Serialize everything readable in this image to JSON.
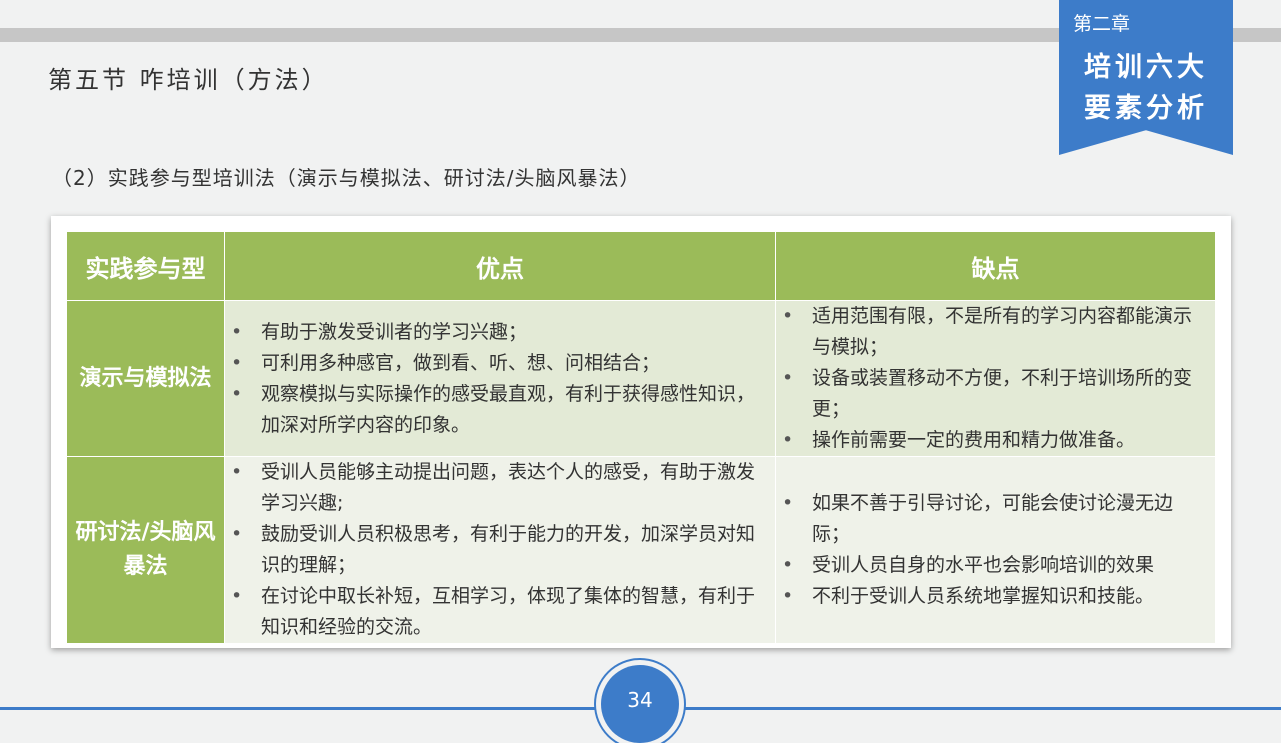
{
  "ribbon": {
    "chapter": "第二章",
    "line1": "培训六大",
    "line2": "要素分析"
  },
  "section_title": "第五节  咋培训（方法）",
  "subtitle": "（2）实践参与型培训法（演示与模拟法、研讨法/头脑风暴法）",
  "table": {
    "headers": [
      "实践参与型",
      "优点",
      "缺点"
    ],
    "rows": [
      {
        "name": "演示与模拟法",
        "pros": [
          "有助于激发受训者的学习兴趣；",
          "可利用多种感官，做到看、听、想、问相结合；",
          "观察模拟与实际操作的感受最直观，有利于获得感性知识，加深对所学内容的印象。"
        ],
        "cons": [
          "适用范围有限，不是所有的学习内容都能演示与模拟；",
          "设备或装置移动不方便，不利于培训场所的变更；",
          "操作前需要一定的费用和精力做准备。"
        ]
      },
      {
        "name": "研讨法/头脑风暴法",
        "pros": [
          "受训人员能够主动提出问题，表达个人的感受，有助于激发学习兴趣;",
          "鼓励受训人员积极思考，有利于能力的开发，加深学员对知识的理解；",
          "在讨论中取长补短，互相学习，体现了集体的智慧，有利于知识和经验的交流。"
        ],
        "cons": [
          "如果不善于引导讨论，可能会使讨论漫无边际；",
          "受训人员自身的水平也会影响培训的效果",
          "不利于受训人员系统地掌握知识和技能。"
        ]
      }
    ]
  },
  "page_number": "34"
}
